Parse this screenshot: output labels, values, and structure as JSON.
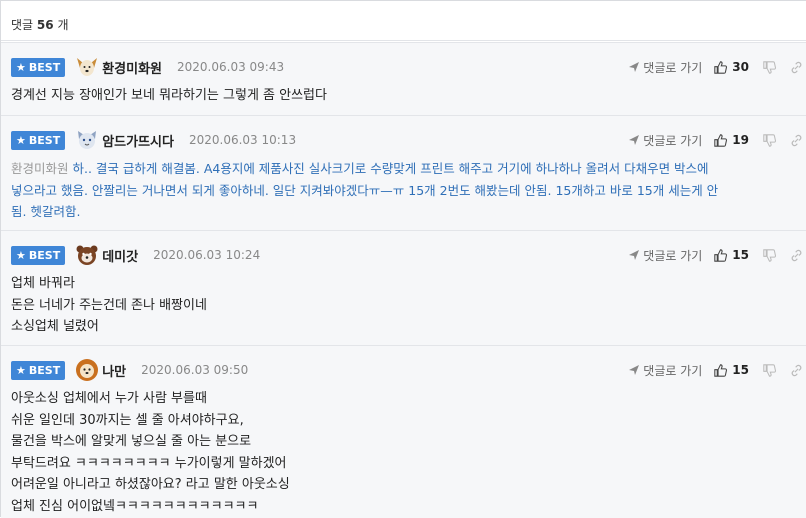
{
  "header": {
    "label": "댓글",
    "count": "56",
    "suffix": "개"
  },
  "comments": [
    {
      "badge": "BEST",
      "nickname": "환경미화원",
      "datetime": "2020.06.03 09:43",
      "reply_label": "댓글로 가기",
      "likes": "30",
      "avatar_icon": "dog-avatar-icon",
      "lines": [
        "경계선 지능 장애인가 보네 뭐라하기는 그렇게 좀 안쓰럽다"
      ]
    },
    {
      "badge": "BEST",
      "nickname": "암드가뜨시다",
      "datetime": "2020.06.03 10:13",
      "reply_label": "댓글로 가기",
      "likes": "19",
      "avatar_icon": "cat-avatar-icon",
      "mention": "환경미화원",
      "lines": [
        "하.. 결국 급하게 해결봄. A4용지에 제품사진 실사크기로 수량맞게 프린트 해주고 거기에 하나하나 올려서 다채우면 박스에",
        "넣으라고 했음. 안짤리는 거나면서 되게 좋아하네. 일단 지켜봐야겠다ㅠ—ㅠ 15개 2번도 해봤는데 안됨. 15개하고 바로 15개 세는게 안",
        "됨. 헷갈려함."
      ]
    },
    {
      "badge": "BEST",
      "nickname": "데미갓",
      "datetime": "2020.06.03 10:24",
      "reply_label": "댓글로 가기",
      "likes": "15",
      "avatar_icon": "bear-avatar-icon",
      "lines": [
        "업체 바꿔라",
        "돈은 너네가 주는건데 존나 배짱이네",
        "소싱업체 널렸어"
      ]
    },
    {
      "badge": "BEST",
      "nickname": "나만",
      "datetime": "2020.06.03 09:50",
      "reply_label": "댓글로 가기",
      "likes": "15",
      "avatar_icon": "lion-avatar-icon",
      "lines": [
        "아웃소싱 업체에서 누가 사람 부를때",
        "쉬운 일인데 30까지는 셀 줄 아셔야하구요,",
        "물건을 박스에 알맞게 넣으실 줄 아는 분으로",
        "부탁드려요 ㅋㅋㅋㅋㅋㅋㅋㅋ 누가이렇게 말하겠어",
        "어려운일 아니라고 하셨잖아요? 라고 말한 아웃소싱",
        "업체 진심 어이없넼ㅋㅋㅋㅋㅋㅋㅋㅋㅋㅋㅋㅋ"
      ]
    }
  ]
}
